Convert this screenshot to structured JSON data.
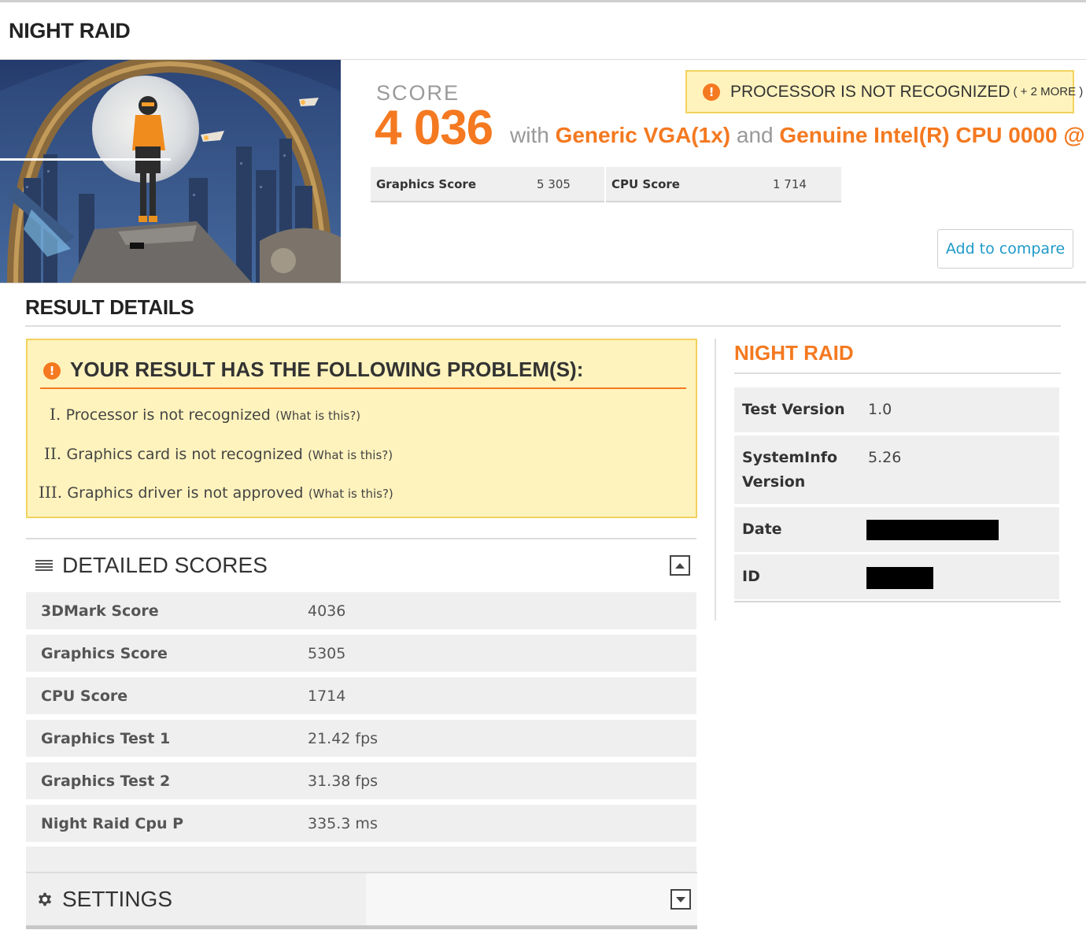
{
  "page": {
    "title": "NIGHT RAID"
  },
  "hero": {
    "image": "night-raid-artwork",
    "score_label": "SCORE",
    "score_value": "4 036",
    "with_text": "with",
    "gpu": "Generic VGA(1x)",
    "and_text": "and",
    "cpu": "Genuine Intel(R) CPU 0000 @",
    "warning": {
      "icon": "warning-icon",
      "text": "PROCESSOR IS NOT RECOGNIZED",
      "more": "( + 2 MORE )"
    },
    "subscores": [
      {
        "label": "Graphics Score",
        "value": "5 305"
      },
      {
        "label": "CPU Score",
        "value": "1 714"
      }
    ],
    "compare_button": "Add to compare"
  },
  "result_details": {
    "title": "RESULT DETAILS",
    "problems": {
      "icon": "warning-icon",
      "title": "YOUR RESULT HAS THE FOLLOWING PROBLEM(S):",
      "items": [
        {
          "num": "I.",
          "text": "Processor is not recognized",
          "link": "(What is this?)"
        },
        {
          "num": "II.",
          "text": "Graphics card is not recognized",
          "link": "(What is this?)"
        },
        {
          "num": "III.",
          "text": "Graphics driver is not approved",
          "link": "(What is this?)"
        }
      ]
    },
    "detailed_scores": {
      "title": "DETAILED SCORES",
      "icon": "list-icon",
      "rows": [
        {
          "label": "3DMark Score",
          "value": "4036"
        },
        {
          "label": "Graphics Score",
          "value": "5305"
        },
        {
          "label": "CPU Score",
          "value": "1714"
        },
        {
          "label": "Graphics Test 1",
          "value": "21.42 fps"
        },
        {
          "label": "Graphics Test 2",
          "value": "31.38 fps"
        },
        {
          "label": "Night Raid Cpu P",
          "value": "335.3 ms"
        }
      ]
    },
    "settings": {
      "title": "SETTINGS",
      "icon": "gear-icon"
    }
  },
  "sidebar": {
    "title": "NIGHT RAID",
    "rows": [
      {
        "label": "Test Version",
        "value": "1.0"
      },
      {
        "label": "SystemInfo Version",
        "value": "5.26"
      },
      {
        "label": "Date",
        "value": ""
      },
      {
        "label": "ID",
        "value": ""
      }
    ]
  },
  "colors": {
    "accent": "#f47920",
    "warning_bg": "#fff3bd",
    "warning_border": "#f2d25d",
    "link": "#1e9ac9",
    "row_bg": "#efefef"
  }
}
